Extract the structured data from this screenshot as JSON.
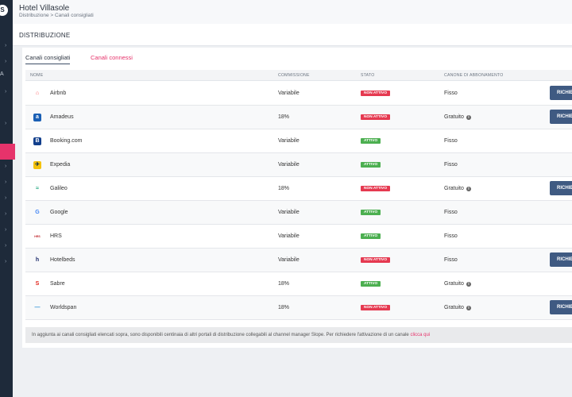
{
  "header": {
    "app_title": "Hotel Villasole",
    "breadcrumb": "Distribuzione > Canali consigliati"
  },
  "section": {
    "title": "DISTRIBUZIONE"
  },
  "tabs": [
    {
      "label": "Canali consigliati",
      "active": true
    },
    {
      "label": "Canali connessi",
      "active": false
    }
  ],
  "table": {
    "columns": [
      "NOME",
      "COMMISSIONE",
      "STATO",
      "CANONE DI ABBONAMENTO"
    ],
    "rows": [
      {
        "name": "Airbnb",
        "logo": "airbnb-logo",
        "commission": "Variabile",
        "status": "NON ATTIVO",
        "fee": "Fisso",
        "fee_info": false,
        "action": "RICHIEDI"
      },
      {
        "name": "Amadeus",
        "logo": "amadeus-logo",
        "commission": "18%",
        "status": "NON ATTIVO",
        "fee": "Gratuito",
        "fee_info": true,
        "action": "RICHIEDI"
      },
      {
        "name": "Booking.com",
        "logo": "booking-logo",
        "commission": "Variabile",
        "status": "ATTIVO",
        "fee": "Fisso",
        "fee_info": false,
        "action": ""
      },
      {
        "name": "Expedia",
        "logo": "expedia-logo",
        "commission": "Variabile",
        "status": "ATTIVO",
        "fee": "Fisso",
        "fee_info": false,
        "action": ""
      },
      {
        "name": "Galileo",
        "logo": "galileo-logo",
        "commission": "18%",
        "status": "NON ATTIVO",
        "fee": "Gratuito",
        "fee_info": true,
        "action": "RICHIEDI"
      },
      {
        "name": "Google",
        "logo": "google-logo",
        "commission": "Variabile",
        "status": "ATTIVO",
        "fee": "Fisso",
        "fee_info": false,
        "action": ""
      },
      {
        "name": "HRS",
        "logo": "hrs-logo",
        "commission": "Variabile",
        "status": "ATTIVO",
        "fee": "Fisso",
        "fee_info": false,
        "action": ""
      },
      {
        "name": "Hotelbeds",
        "logo": "hotelbeds-logo",
        "commission": "Variabile",
        "status": "NON ATTIVO",
        "fee": "Fisso",
        "fee_info": false,
        "action": "RICHIEDI"
      },
      {
        "name": "Sabre",
        "logo": "sabre-logo",
        "commission": "18%",
        "status": "ATTIVO",
        "fee": "Gratuito",
        "fee_info": true,
        "action": ""
      },
      {
        "name": "Worldspan",
        "logo": "worldspan-logo",
        "commission": "18%",
        "status": "NON ATTIVO",
        "fee": "Gratuito",
        "fee_info": true,
        "action": "RICHIEDI"
      }
    ]
  },
  "footer": {
    "note": "In aggiunta ai canali consigliati elencati sopra, sono disponibili centinaia di altri portali di distribuzione collegabili al channel manager Slope. Per richiedere l'attivazione di un canale ",
    "link": "clicca qui"
  },
  "colors": {
    "accent": "#e6336b",
    "active_status": "#4caf50",
    "inactive_status": "#e53950",
    "button": "#3f5a82",
    "nav": "#1e2a3a"
  }
}
